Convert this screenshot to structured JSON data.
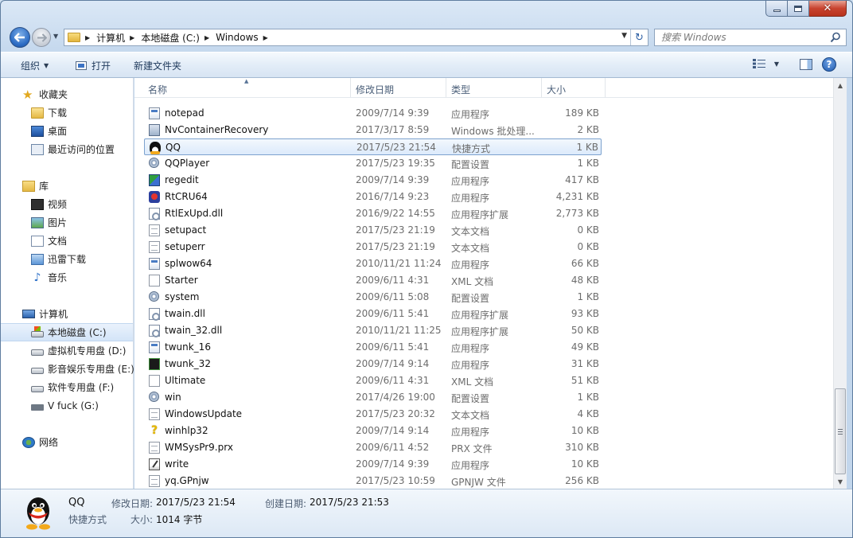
{
  "window": {
    "breadcrumbs": [
      "计算机",
      "本地磁盘 (C:)",
      "Windows"
    ],
    "search_placeholder": "搜索 Windows"
  },
  "toolbar": {
    "organize_label": "组织",
    "open_label": "打开",
    "new_folder_label": "新建文件夹"
  },
  "nav": {
    "favorites": "收藏夹",
    "downloads": "下载",
    "desktop": "桌面",
    "recent": "最近访问的位置",
    "libraries": "库",
    "videos": "视频",
    "pictures": "图片",
    "documents": "文档",
    "xunlei": "迅雷下载",
    "music": "音乐",
    "computer": "计算机",
    "drive_c": "本地磁盘 (C:)",
    "drive_d": "虚拟机专用盘 (D:)",
    "drive_e": "影音娱乐专用盘 (E:)",
    "drive_f": "软件专用盘 (F:)",
    "drive_g": "V fuck (G:)",
    "network": "网络"
  },
  "columns": {
    "name": "名称",
    "date": "修改日期",
    "type": "类型",
    "size": "大小"
  },
  "files": [
    {
      "name": "notepad",
      "date": "2009/7/14 9:39",
      "type": "应用程序",
      "size": "189 KB",
      "icon": "app-icon"
    },
    {
      "name": "NvContainerRecovery",
      "date": "2017/3/17 8:59",
      "type": "Windows 批处理...",
      "size": "2 KB",
      "icon": "batch-file-icon"
    },
    {
      "name": "QQ",
      "date": "2017/5/23 21:54",
      "type": "快捷方式",
      "size": "1 KB",
      "icon": "qq-penguin-icon"
    },
    {
      "name": "QQPlayer",
      "date": "2017/5/23 19:35",
      "type": "配置设置",
      "size": "1 KB",
      "icon": "config-gear-icon"
    },
    {
      "name": "regedit",
      "date": "2009/7/14 9:39",
      "type": "应用程序",
      "size": "417 KB",
      "icon": "regedit-icon"
    },
    {
      "name": "RtCRU64",
      "date": "2016/7/14 9:23",
      "type": "应用程序",
      "size": "4,231 KB",
      "icon": "realtek-icon"
    },
    {
      "name": "RtlExUpd.dll",
      "date": "2016/9/22 14:55",
      "type": "应用程序扩展",
      "size": "2,773 KB",
      "icon": "dll-icon"
    },
    {
      "name": "setupact",
      "date": "2017/5/23 21:19",
      "type": "文本文档",
      "size": "0 KB",
      "icon": "text-file-icon"
    },
    {
      "name": "setuperr",
      "date": "2017/5/23 21:19",
      "type": "文本文档",
      "size": "0 KB",
      "icon": "text-file-icon"
    },
    {
      "name": "splwow64",
      "date": "2010/11/21 11:24",
      "type": "应用程序",
      "size": "66 KB",
      "icon": "app-icon"
    },
    {
      "name": "Starter",
      "date": "2009/6/11 4:31",
      "type": "XML 文档",
      "size": "48 KB",
      "icon": "xml-file-icon"
    },
    {
      "name": "system",
      "date": "2009/6/11 5:08",
      "type": "配置设置",
      "size": "1 KB",
      "icon": "config-gear-icon"
    },
    {
      "name": "twain.dll",
      "date": "2009/6/11 5:41",
      "type": "应用程序扩展",
      "size": "93 KB",
      "icon": "dll-icon"
    },
    {
      "name": "twain_32.dll",
      "date": "2010/11/21 11:25",
      "type": "应用程序扩展",
      "size": "50 KB",
      "icon": "dll-icon"
    },
    {
      "name": "twunk_16",
      "date": "2009/6/11 5:41",
      "type": "应用程序",
      "size": "49 KB",
      "icon": "app-icon"
    },
    {
      "name": "twunk_32",
      "date": "2009/7/14 9:14",
      "type": "应用程序",
      "size": "31 KB",
      "icon": "dos-app-icon"
    },
    {
      "name": "Ultimate",
      "date": "2009/6/11 4:31",
      "type": "XML 文档",
      "size": "51 KB",
      "icon": "xml-file-icon"
    },
    {
      "name": "win",
      "date": "2017/4/26 19:00",
      "type": "配置设置",
      "size": "1 KB",
      "icon": "config-gear-icon"
    },
    {
      "name": "WindowsUpdate",
      "date": "2017/5/23 20:32",
      "type": "文本文档",
      "size": "4 KB",
      "icon": "text-file-icon"
    },
    {
      "name": "winhlp32",
      "date": "2009/7/14 9:14",
      "type": "应用程序",
      "size": "10 KB",
      "icon": "help-icon"
    },
    {
      "name": "WMSysPr9.prx",
      "date": "2009/6/11 4:52",
      "type": "PRX 文件",
      "size": "310 KB",
      "icon": "generic-file-icon"
    },
    {
      "name": "write",
      "date": "2009/7/14 9:39",
      "type": "应用程序",
      "size": "10 KB",
      "icon": "wordpad-icon"
    },
    {
      "name": "yq.GPnjw",
      "date": "2017/5/23 10:59",
      "type": "GPNJW 文件",
      "size": "256 KB",
      "icon": "generic-file-icon"
    }
  ],
  "selected_file": "QQ",
  "details": {
    "name": "QQ",
    "kind": "快捷方式",
    "modified_label": "修改日期:",
    "modified_value": "2017/5/23 21:54",
    "created_label": "创建日期:",
    "created_value": "2017/5/23 21:53",
    "size_label": "大小:",
    "size_value": "1014 字节"
  }
}
